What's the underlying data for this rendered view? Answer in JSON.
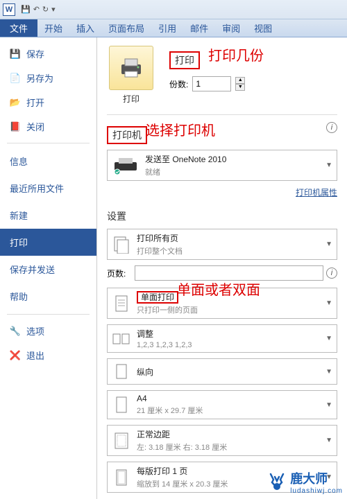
{
  "titlebar": {
    "app_letter": "W",
    "save_tip": "保存",
    "undo_tip": "↶",
    "redo_tip": "↷"
  },
  "ribbon": {
    "file": "文件",
    "home": "开始",
    "insert": "插入",
    "layout": "页面布局",
    "references": "引用",
    "mail": "邮件",
    "review": "审阅",
    "view": "视图"
  },
  "side": {
    "save": "保存",
    "save_as": "另存为",
    "open": "打开",
    "close": "关闭",
    "info": "信息",
    "recent": "最近所用文件",
    "new": "新建",
    "print": "打印",
    "save_send": "保存并发送",
    "help": "帮助",
    "options": "选项",
    "exit": "退出"
  },
  "print": {
    "btn_label": "打印",
    "header": "打印",
    "copies_label": "份数:",
    "copies_value": "1",
    "printer_header": "打印机",
    "printer_name": "发送至 OneNote 2010",
    "printer_status": "就绪",
    "printer_props": "打印机属性",
    "settings_header": "设置",
    "scope_title": "打印所有页",
    "scope_sub": "打印整个文档",
    "pages_label": "页数:",
    "pages_value": "",
    "sided_title": "单面打印",
    "sided_sub": "只打印一侧的页面",
    "collate_title": "调整",
    "collate_sub": "1,2,3    1,2,3    1,2,3",
    "orient_title": "纵向",
    "paper_title": "A4",
    "paper_sub": "21 厘米 x 29.7 厘米",
    "margin_title": "正常边距",
    "margin_sub": "左:  3.18 厘米   右:  3.18 厘米",
    "perpage_title": "每版打印 1 页",
    "perpage_sub": "缩放到 14 厘米 x 20.3 厘米"
  },
  "annotations": {
    "copies": "打印几份",
    "printer": "选择打印机",
    "sided": "单面或者双面"
  },
  "watermark": {
    "name": "鹿大师",
    "url": "ludashiwj.com"
  }
}
